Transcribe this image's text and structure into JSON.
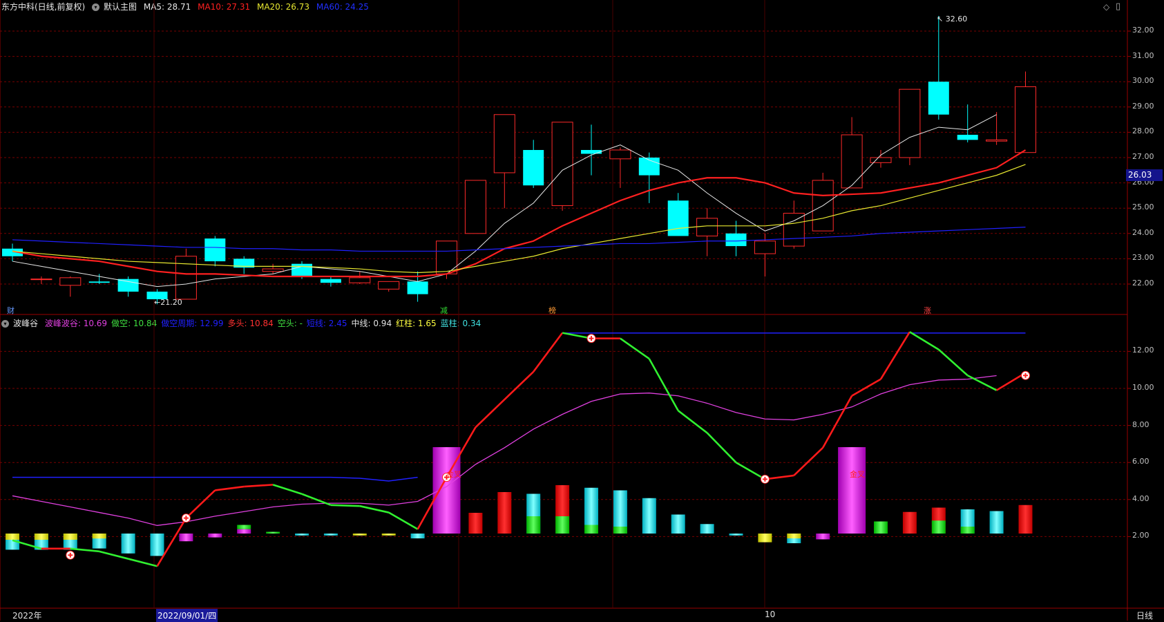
{
  "main_header": {
    "stock_name": "东方中科(日线,前复权)",
    "template": "默认主图",
    "ma5": "MA5: 28.71",
    "ma10": "MA10: 27.31",
    "ma20": "MA20: 26.73",
    "ma60": "MA60: 24.25"
  },
  "indicator_header": {
    "name": "波峰谷",
    "items": [
      {
        "text": "波峰波谷: 10.69",
        "color": "#e040e0"
      },
      {
        "text": "做空: 10.84",
        "color": "#40e040"
      },
      {
        "text": "做空周期: 12.99",
        "color": "#2020ff"
      },
      {
        "text": "多头: 10.84",
        "color": "#ff3030"
      },
      {
        "text": "空头: -",
        "color": "#40e040"
      },
      {
        "text": "短线: 2.45",
        "color": "#2020ff"
      },
      {
        "text": "中线: 0.94",
        "color": "#e0e0e0"
      },
      {
        "text": "红柱: 1.65",
        "color": "#ffff40"
      },
      {
        "text": "蓝柱: 0.34",
        "color": "#40e0e0"
      }
    ]
  },
  "price_axis": {
    "ticks": [
      "32.00",
      "31.00",
      "30.00",
      "29.00",
      "28.00",
      "27.00",
      "26.00",
      "25.00",
      "24.00",
      "23.00",
      "22.00"
    ],
    "current_price": "26.03"
  },
  "indicator_axis": {
    "ticks": [
      "12.00",
      "10.00",
      "8.00",
      "6.00",
      "4.00",
      "2.00"
    ]
  },
  "date_axis": {
    "labels": [
      "2022年",
      "2022/09/01/四",
      "10"
    ],
    "period": "日线"
  },
  "annotations": {
    "high_label": "32.60",
    "low_label": "21.20",
    "events": [
      "财",
      "减",
      "榜",
      "涨"
    ],
    "golden_cross": [
      "金叉",
      "金叉"
    ]
  },
  "colors": {
    "up": "#ff2a2a",
    "down": "#00ffff",
    "ma5": "#e8e8e8",
    "ma10": "#ff2020",
    "ma20": "#e8e830",
    "ma60": "#2020ff",
    "grid": "#7a0000"
  },
  "chart_data": [
    {
      "type": "candlestick",
      "title": "东方中科(日线,前复权)",
      "ylim": [
        21.0,
        33.0
      ],
      "candles": [
        {
          "o": 23.4,
          "c": 23.1,
          "h": 23.6,
          "l": 22.9
        },
        {
          "o": 22.2,
          "c": 22.2,
          "h": 22.3,
          "l": 22.0
        },
        {
          "o": 21.95,
          "c": 22.25,
          "h": 22.3,
          "l": 21.5
        },
        {
          "o": 22.1,
          "c": 22.05,
          "h": 22.4,
          "l": 22.0
        },
        {
          "o": 22.2,
          "c": 21.7,
          "h": 22.3,
          "l": 21.5
        },
        {
          "o": 21.7,
          "c": 21.4,
          "h": 21.8,
          "l": 21.2
        },
        {
          "o": 21.4,
          "c": 23.1,
          "h": 23.4,
          "l": 21.4
        },
        {
          "o": 23.8,
          "c": 22.9,
          "h": 23.9,
          "l": 22.7
        },
        {
          "o": 23.0,
          "c": 22.65,
          "h": 23.1,
          "l": 22.4
        },
        {
          "o": 22.5,
          "c": 22.6,
          "h": 22.8,
          "l": 22.4
        },
        {
          "o": 22.8,
          "c": 22.3,
          "h": 22.9,
          "l": 22.2
        },
        {
          "o": 22.2,
          "c": 22.05,
          "h": 22.3,
          "l": 21.9
        },
        {
          "o": 22.05,
          "c": 22.25,
          "h": 22.5,
          "l": 22.0
        },
        {
          "o": 21.8,
          "c": 22.1,
          "h": 22.1,
          "l": 21.7
        },
        {
          "o": 22.1,
          "c": 21.6,
          "h": 22.5,
          "l": 21.3
        },
        {
          "o": 22.4,
          "c": 23.7,
          "h": 23.7,
          "l": 22.2
        },
        {
          "o": 24.0,
          "c": 26.1,
          "h": 26.1,
          "l": 24.0
        },
        {
          "o": 26.4,
          "c": 28.7,
          "h": 28.7,
          "l": 25.0
        },
        {
          "o": 27.3,
          "c": 25.9,
          "h": 27.7,
          "l": 25.8
        },
        {
          "o": 25.1,
          "c": 28.4,
          "h": 28.4,
          "l": 24.9
        },
        {
          "o": 27.3,
          "c": 27.15,
          "h": 28.3,
          "l": 26.3
        },
        {
          "o": 26.95,
          "c": 27.3,
          "h": 27.4,
          "l": 25.8
        },
        {
          "o": 27.0,
          "c": 26.3,
          "h": 27.2,
          "l": 25.2
        },
        {
          "o": 25.3,
          "c": 23.9,
          "h": 25.6,
          "l": 23.9
        },
        {
          "o": 23.9,
          "c": 24.6,
          "h": 25.0,
          "l": 23.1
        },
        {
          "o": 24.0,
          "c": 23.5,
          "h": 24.5,
          "l": 23.1
        },
        {
          "o": 23.2,
          "c": 23.7,
          "h": 24.0,
          "l": 22.3
        },
        {
          "o": 23.5,
          "c": 24.8,
          "h": 25.3,
          "l": 23.4
        },
        {
          "o": 24.1,
          "c": 26.1,
          "h": 26.4,
          "l": 24.1
        },
        {
          "o": 25.8,
          "c": 27.9,
          "h": 28.6,
          "l": 25.8
        },
        {
          "o": 26.8,
          "c": 27.0,
          "h": 27.3,
          "l": 26.6
        },
        {
          "o": 27.0,
          "c": 29.7,
          "h": 29.7,
          "l": 26.7
        },
        {
          "o": 30.0,
          "c": 28.7,
          "h": 32.6,
          "l": 28.5
        },
        {
          "o": 27.9,
          "c": 27.7,
          "h": 29.1,
          "l": 27.6
        },
        {
          "o": 27.65,
          "c": 27.7,
          "h": 28.8,
          "l": 27.5
        },
        {
          "o": 27.2,
          "c": 29.8,
          "h": 30.4,
          "l": 27.2
        }
      ],
      "series": [
        {
          "name": "MA5",
          "values": [
            22.9,
            22.7,
            22.5,
            22.3,
            22.1,
            21.9,
            22.0,
            22.2,
            22.3,
            22.4,
            22.7,
            22.6,
            22.5,
            22.3,
            22.1,
            22.4,
            23.3,
            24.4,
            25.2,
            26.5,
            27.1,
            27.5,
            26.9,
            26.5,
            25.6,
            24.8,
            24.1,
            24.5,
            25.1,
            25.9,
            27.1,
            27.8,
            28.2,
            28.1,
            28.7
          ]
        },
        {
          "name": "MA10",
          "values": [
            23.3,
            23.1,
            23.0,
            22.9,
            22.7,
            22.5,
            22.4,
            22.4,
            22.35,
            22.3,
            22.3,
            22.3,
            22.3,
            22.3,
            22.3,
            22.4,
            22.8,
            23.4,
            23.7,
            24.3,
            24.8,
            25.3,
            25.7,
            26.0,
            26.2,
            26.2,
            26.0,
            25.6,
            25.5,
            25.55,
            25.6,
            25.8,
            26.0,
            26.3,
            26.6,
            27.3
          ]
        },
        {
          "name": "MA20",
          "values": [
            23.3,
            23.2,
            23.1,
            23.0,
            22.9,
            22.85,
            22.8,
            22.75,
            22.7,
            22.7,
            22.7,
            22.65,
            22.6,
            22.5,
            22.45,
            22.5,
            22.7,
            22.9,
            23.1,
            23.4,
            23.6,
            23.8,
            24.0,
            24.2,
            24.3,
            24.3,
            24.3,
            24.4,
            24.6,
            24.9,
            25.1,
            25.4,
            25.7,
            26.0,
            26.3,
            26.73
          ]
        },
        {
          "name": "MA60",
          "values": [
            23.75,
            23.7,
            23.65,
            23.6,
            23.55,
            23.5,
            23.45,
            23.45,
            23.4,
            23.4,
            23.35,
            23.35,
            23.3,
            23.3,
            23.3,
            23.3,
            23.35,
            23.4,
            23.45,
            23.5,
            23.55,
            23.6,
            23.6,
            23.65,
            23.7,
            23.7,
            23.75,
            23.8,
            23.85,
            23.9,
            24.0,
            24.05,
            24.1,
            24.15,
            24.2,
            24.25
          ]
        }
      ]
    },
    {
      "type": "line",
      "title": "波峰谷",
      "ylim": [
        -1.5,
        13.5
      ],
      "series": [
        {
          "name": "波峰波谷",
          "values": [
            4.2,
            3.9,
            3.6,
            3.3,
            3.0,
            2.6,
            2.8,
            3.1,
            3.35,
            3.6,
            3.75,
            3.8,
            3.8,
            3.7,
            3.9,
            4.7,
            5.9,
            6.8,
            7.8,
            8.6,
            9.3,
            9.7,
            9.75,
            9.6,
            9.2,
            8.7,
            8.35,
            8.3,
            8.6,
            9.0,
            9.7,
            10.2,
            10.45,
            10.5,
            10.69
          ]
        },
        {
          "name": "做空周期",
          "values": [
            5.2,
            5.2,
            5.2,
            5.2,
            5.2,
            5.2,
            5.2,
            5.2,
            5.2,
            5.2,
            5.2,
            5.2,
            5.15,
            5.0,
            5.2,
            12.99,
            12.99,
            12.99,
            12.99,
            12.99,
            12.99,
            12.99,
            12.99,
            12.99,
            12.99,
            12.99,
            12.99,
            12.99,
            12.99,
            12.99,
            12.99,
            12.99,
            12.99,
            12.99,
            12.99
          ]
        },
        {
          "name": "多头/做空",
          "values": [
            1.8,
            1.35,
            1.35,
            1.2,
            0.8,
            0.4,
            3.0,
            4.5,
            4.7,
            4.8,
            4.3,
            3.7,
            3.65,
            3.3,
            2.4,
            5.2,
            7.9,
            9.4,
            10.9,
            13.0,
            12.7,
            12.7,
            11.6,
            8.8,
            7.6,
            6.0,
            5.1,
            5.3,
            6.8,
            9.6,
            10.5,
            13.05,
            12.1,
            10.7,
            9.9,
            10.84
          ]
        }
      ],
      "bars": [
        {
          "cyan": 1.3,
          "color": "cyan",
          "yellow": 0.5
        },
        {
          "cyan": 1.3,
          "color": "cyan",
          "yellow": 0.5
        },
        {
          "cyan": 1.3,
          "color": "cyan",
          "yellow": 0.5
        },
        {
          "cyan": 1.2,
          "color": "cyan",
          "yellow": 0.4
        },
        {
          "cyan": 1.6,
          "color": "cyan"
        },
        {
          "cyan": 1.8,
          "color": "cyan"
        },
        {
          "val": -0.8,
          "color": "magenta"
        },
        {
          "val": -0.4,
          "color": "magenta"
        },
        {
          "val": 0.5,
          "color": "green-magenta"
        },
        {
          "val": 0.1,
          "color": "green"
        },
        {
          "val": -0.2,
          "color": "cyan"
        },
        {
          "val": -0.2,
          "color": "cyan"
        },
        {
          "val": -0.2,
          "color": "yellow"
        },
        {
          "val": -0.2,
          "color": "yellow"
        },
        {
          "val": -0.5,
          "color": "cyan"
        },
        {
          "val": 5.0,
          "color": "magenta"
        },
        {
          "val": 1.2,
          "color": "red"
        },
        {
          "val": 2.4,
          "color": "red"
        },
        {
          "val": 2.3,
          "color": "cyan-green",
          "green": 1.0
        },
        {
          "val": 2.8,
          "color": "red-green",
          "green": 1.0
        },
        {
          "val": 2.65,
          "color": "cyan-green",
          "green": 0.5
        },
        {
          "val": 2.5,
          "color": "cyan-green",
          "green": 0.4
        },
        {
          "val": 2.05,
          "color": "cyan"
        },
        {
          "val": 1.1,
          "color": "cyan"
        },
        {
          "val": 0.55,
          "color": "cyan"
        },
        {
          "val": -0.2,
          "color": "cyan"
        },
        {
          "val": -0.9,
          "color": "yellow"
        },
        {
          "val": -1.0,
          "color": "cyan-yellow"
        },
        {
          "val": -0.6,
          "color": "magenta"
        },
        {
          "val": 5.0,
          "color": "magenta"
        },
        {
          "val": 0.7,
          "color": "green"
        },
        {
          "val": 1.25,
          "color": "red"
        },
        {
          "val": 1.5,
          "color": "red-green",
          "green": 0.75
        },
        {
          "val": 1.4,
          "color": "cyan-green",
          "green": 0.4
        },
        {
          "val": 1.3,
          "color": "cyan"
        },
        {
          "val": 1.65,
          "color": "red"
        }
      ]
    }
  ]
}
